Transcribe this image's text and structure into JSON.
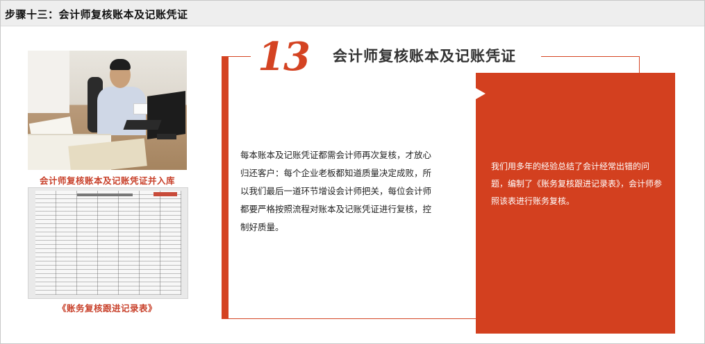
{
  "header": {
    "title": "步骤十三：会计师复核账本及记账凭证"
  },
  "left": {
    "photo_caption": "会计师复核账本及记账凭证并入库",
    "form_caption": "《账务复核跟进记录表》"
  },
  "main": {
    "step_number": "13",
    "title": "会计师复核账本及记账凭证",
    "body": "每本账本及记账凭证都需会计师再次复核，才放心归还客户：每个企业老板都知道质量决定成败，所以我们最后一道环节增设会计师把关，每位会计师都要严格按照流程对账本及记账凭证进行复核，控制好质量。",
    "panel_text": "我们用多年的经验总结了会计经常出错的问题，编制了《账务复核跟进记录表》，会计师参照该表进行账务复核。"
  },
  "colors": {
    "accent": "#d44322",
    "panel": "#d3401f",
    "header_bg": "#eeeeee"
  },
  "icons": {
    "panel_marker": "play-icon"
  }
}
